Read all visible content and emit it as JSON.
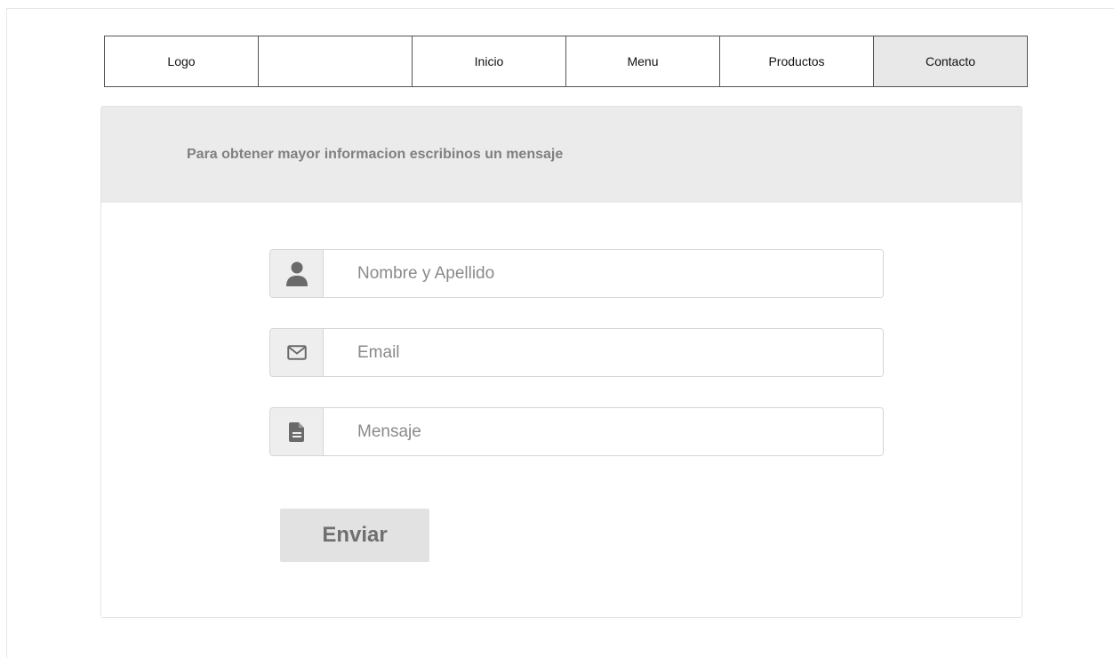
{
  "nav": {
    "items": [
      {
        "label": "Logo",
        "active": false
      },
      {
        "label": "",
        "active": false
      },
      {
        "label": "Inicio",
        "active": false
      },
      {
        "label": "Menu",
        "active": false
      },
      {
        "label": "Productos",
        "active": false
      },
      {
        "label": "Contacto",
        "active": true
      }
    ]
  },
  "contact": {
    "header": "Para obtener mayor informacion escribinos un mensaje",
    "fields": [
      {
        "icon": "user-icon",
        "placeholder": "Nombre y Apellido"
      },
      {
        "icon": "envelope-icon",
        "placeholder": "Email"
      },
      {
        "icon": "document-icon",
        "placeholder": "Mensaje"
      }
    ],
    "submit_label": "Enviar"
  },
  "colors": {
    "active_nav_bg": "#e8e8e8",
    "header_bg": "#ebebeb",
    "button_bg": "#e2e2e2",
    "icon_color": "#6a6a6a"
  }
}
